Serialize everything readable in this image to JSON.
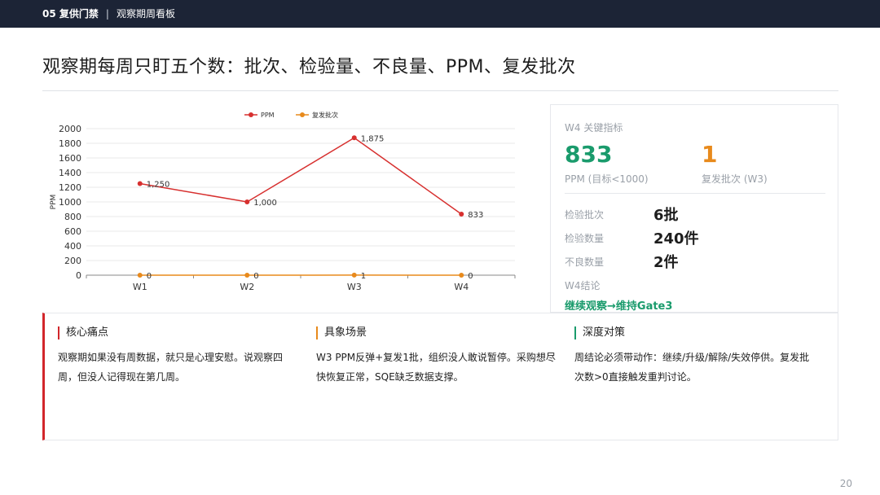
{
  "header": {
    "section": "05 复供门禁",
    "separator": "|",
    "subtitle": "观察期周看板"
  },
  "page_title": "观察期每周只盯五个数：批次、检验量、不良量、PPM、复发批次",
  "chart_data": {
    "type": "line",
    "categories": [
      "W1",
      "W2",
      "W3",
      "W4"
    ],
    "series": [
      {
        "name": "PPM",
        "values": [
          1250,
          1000,
          1875,
          833
        ],
        "labels": [
          "1,250",
          "1,000",
          "1,875",
          "833"
        ],
        "color": "#d7302f"
      },
      {
        "name": "复发批次",
        "values": [
          0,
          0,
          1,
          0
        ],
        "labels": [
          "0",
          "0",
          "1",
          "0"
        ],
        "color": "#e88a1c"
      }
    ],
    "ylabel": "PPM",
    "ylim": [
      0,
      2000
    ],
    "yticks": [
      0,
      200,
      400,
      600,
      800,
      1000,
      1200,
      1400,
      1600,
      1800,
      2000
    ],
    "grid": true,
    "legend": "top-center"
  },
  "kpi": {
    "heading": "W4 关键指标",
    "ppm_value": "833",
    "ppm_caption": "PPM (目标<1000)",
    "recur_value": "1",
    "recur_caption": "复发批次 (W3)",
    "rows": [
      {
        "label": "检验批次",
        "value": "6批"
      },
      {
        "label": "检验数量",
        "value": "240件"
      },
      {
        "label": "不良数量",
        "value": "2件"
      }
    ],
    "conclusion_label": "W4结论",
    "conclusion": "继续观察→维持Gate3"
  },
  "cards": [
    {
      "title": "核心痛点",
      "body": "观察期如果没有周数据，就只是心理安慰。说观察四周，但没人记得现在第几周。"
    },
    {
      "title": "具象场景",
      "body": "W3 PPM反弹+复发1批，组织没人敢说暂停。采购想尽快恢复正常，SQE缺乏数据支撑。"
    },
    {
      "title": "深度对策",
      "body": "周结论必须带动作：继续/升级/解除/失效停供。复发批次数>0直接触发重判讨论。"
    }
  ],
  "page_number": "20",
  "colors": {
    "header_bg": "#1c2436",
    "accent_red": "#d2262b",
    "accent_green": "#1a9b6c",
    "accent_orange": "#e88a1c"
  }
}
